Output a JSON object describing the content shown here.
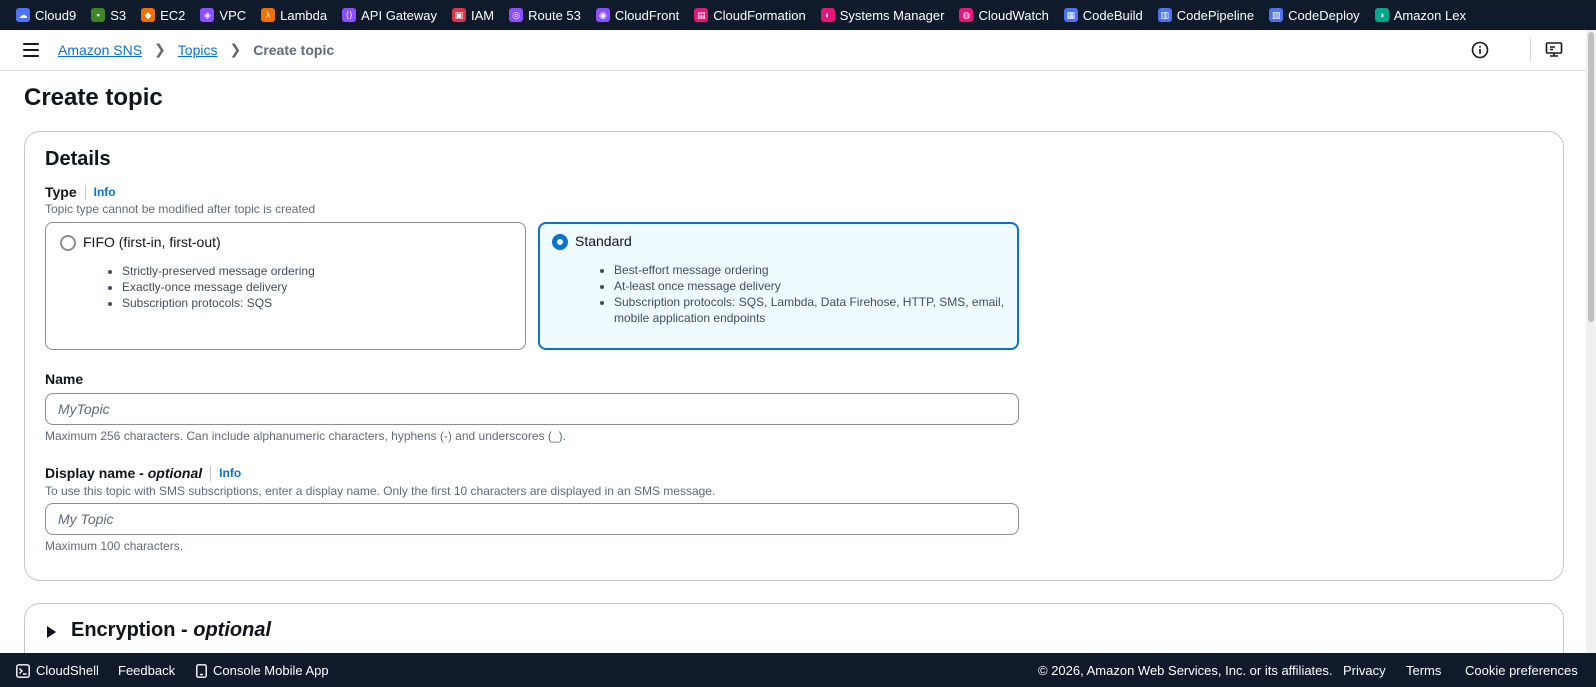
{
  "services": [
    {
      "label": "Cloud9",
      "icon": "cloud9-icon",
      "color": "#4d72f3"
    },
    {
      "label": "S3",
      "icon": "s3-icon",
      "color": "#3f8624"
    },
    {
      "label": "EC2",
      "icon": "ec2-icon",
      "color": "#ed7100"
    },
    {
      "label": "VPC",
      "icon": "vpc-icon",
      "color": "#8c4fff"
    },
    {
      "label": "Lambda",
      "icon": "lambda-icon",
      "color": "#ed7100"
    },
    {
      "label": "API Gateway",
      "icon": "api-gateway-icon",
      "color": "#8c4fff"
    },
    {
      "label": "IAM",
      "icon": "iam-icon",
      "color": "#dd344c"
    },
    {
      "label": "Route 53",
      "icon": "route53-icon",
      "color": "#8c4fff"
    },
    {
      "label": "CloudFront",
      "icon": "cloudfront-icon",
      "color": "#8c4fff"
    },
    {
      "label": "CloudFormation",
      "icon": "cloudformation-icon",
      "color": "#e7157b"
    },
    {
      "label": "Systems Manager",
      "icon": "systems-manager-icon",
      "color": "#e7157b"
    },
    {
      "label": "CloudWatch",
      "icon": "cloudwatch-icon",
      "color": "#e7157b"
    },
    {
      "label": "CodeBuild",
      "icon": "codebuild-icon",
      "color": "#4d72f3"
    },
    {
      "label": "CodePipeline",
      "icon": "codepipeline-icon",
      "color": "#4d72f3"
    },
    {
      "label": "CodeDeploy",
      "icon": "codedeploy-icon",
      "color": "#4d72f3"
    },
    {
      "label": "Amazon Lex",
      "icon": "amazon-lex-icon",
      "color": "#01a88d"
    }
  ],
  "breadcrumb": {
    "root": "Amazon SNS",
    "topics": "Topics",
    "current": "Create topic"
  },
  "page": {
    "title": "Create topic"
  },
  "details": {
    "title": "Details",
    "type_label": "Type",
    "info": "Info",
    "type_desc": "Topic type cannot be modified after topic is created",
    "fifo": {
      "label": "FIFO (first-in, first-out)",
      "selected": false,
      "bullets": [
        "Strictly-preserved message ordering",
        "Exactly-once message delivery",
        "Subscription protocols: SQS"
      ]
    },
    "standard": {
      "label": "Standard",
      "selected": true,
      "bullets": [
        "Best-effort message ordering",
        "At-least once message delivery",
        "Subscription protocols: SQS, Lambda, Data Firehose, HTTP, SMS, email, mobile application endpoints"
      ]
    },
    "name": {
      "label": "Name",
      "placeholder": "MyTopic",
      "value": "",
      "constraint": "Maximum 256 characters. Can include alphanumeric characters, hyphens (-) and underscores (_)."
    },
    "display_name": {
      "label": "Display name - ",
      "optional": "optional",
      "info": "Info",
      "desc": "To use this topic with SMS subscriptions, enter a display name. Only the first 10 characters are displayed in an SMS message.",
      "placeholder": "My Topic",
      "value": "",
      "constraint": "Maximum 100 characters."
    }
  },
  "encryption": {
    "title": "Encryption - ",
    "optional": "optional"
  },
  "footer": {
    "cloudshell": "CloudShell",
    "feedback": "Feedback",
    "mobile_app": "Console Mobile App",
    "copyright": "© 2026, Amazon Web Services, Inc. or its affiliates.",
    "privacy": "Privacy",
    "terms": "Terms",
    "cookies": "Cookie preferences"
  },
  "colors": {
    "nav_bg": "#0f1b2a",
    "link": "#0972d3",
    "selected_tile_bg": "#f0fbff"
  }
}
